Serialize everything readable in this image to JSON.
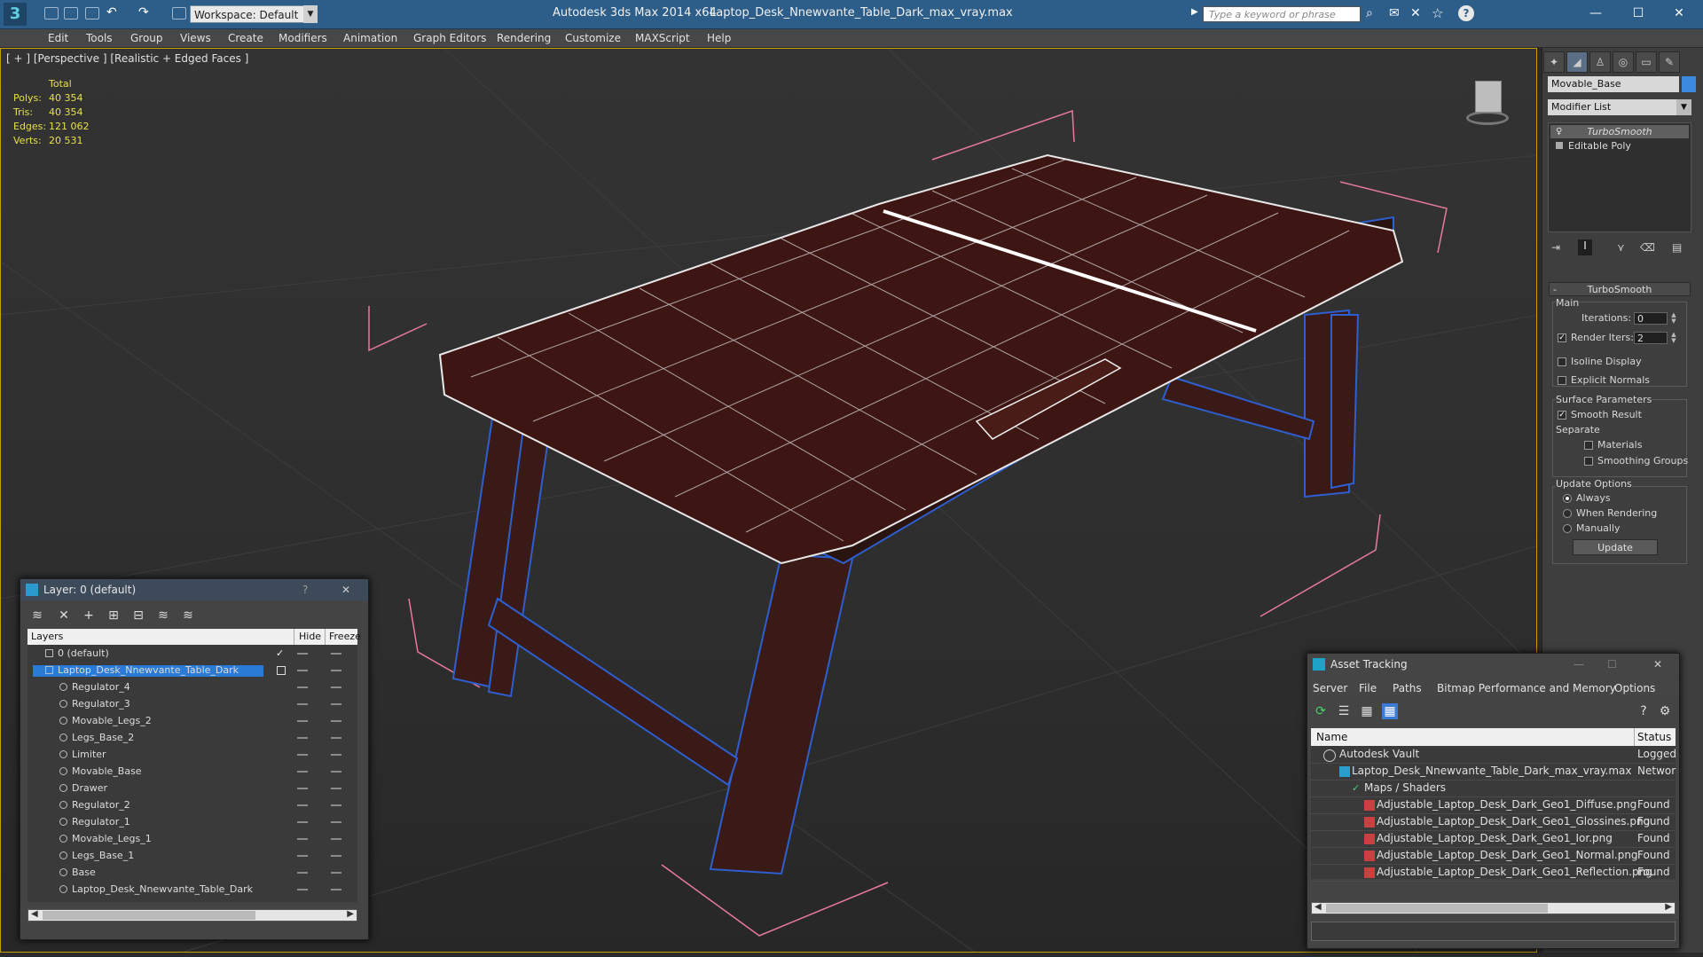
{
  "app": {
    "product_title": "Autodesk 3ds Max  2014 x64",
    "file_title": "Laptop_Desk_Nnewvante_Table_Dark_max_vray.max",
    "workspace_label": "Workspace: Default",
    "search_placeholder": "Type a keyword or phrase"
  },
  "menu": [
    "Edit",
    "Tools",
    "Group",
    "Views",
    "Create",
    "Modifiers",
    "Animation",
    "Graph Editors",
    "Rendering",
    "Customize",
    "MAXScript",
    "Help"
  ],
  "viewport": {
    "label": "[ + ] [Perspective ] [Realistic + Edged Faces ]",
    "stats_header": "Total",
    "stats": [
      {
        "key": "Polys:",
        "value": "40 354"
      },
      {
        "key": "Tris:",
        "value": "40 354"
      },
      {
        "key": "Edges:",
        "value": "121 062"
      },
      {
        "key": "Verts:",
        "value": "20 531"
      }
    ]
  },
  "command_panel": {
    "object_name": "Movable_Base",
    "object_color": "#3a8ae0",
    "modifier_list": "Modifier List",
    "stack": [
      "TurboSmooth",
      "Editable Poly"
    ],
    "turbosmooth": {
      "header": "TurboSmooth",
      "main": "Main",
      "iterations_label": "Iterations:",
      "iterations_value": "0",
      "render_iters_label": "Render Iters:",
      "render_iters_value": "2",
      "isoline": "Isoline Display",
      "explicit": "Explicit Normals",
      "surface_params": "Surface Parameters",
      "smooth_result": "Smooth Result",
      "separate": "Separate",
      "materials": "Materials",
      "smoothing_groups": "Smoothing Groups",
      "update_options": "Update Options",
      "always": "Always",
      "when_rendering": "When Rendering",
      "manually": "Manually",
      "update_button": "Update"
    }
  },
  "layer_window": {
    "title": "Layer: 0 (default)",
    "col_layers": "Layers",
    "col_hide": "Hide",
    "col_freeze": "Freeze",
    "rows": [
      {
        "name": "0 (default)",
        "level": 0
      },
      {
        "name": "Laptop_Desk_Nnewvante_Table_Dark",
        "level": 0,
        "selected": true
      },
      {
        "name": "Regulator_4",
        "level": 1
      },
      {
        "name": "Regulator_3",
        "level": 1
      },
      {
        "name": "Movable_Legs_2",
        "level": 1
      },
      {
        "name": "Legs_Base_2",
        "level": 1
      },
      {
        "name": "Limiter",
        "level": 1
      },
      {
        "name": "Movable_Base",
        "level": 1
      },
      {
        "name": "Drawer",
        "level": 1
      },
      {
        "name": "Regulator_2",
        "level": 1
      },
      {
        "name": "Regulator_1",
        "level": 1
      },
      {
        "name": "Movable_Legs_1",
        "level": 1
      },
      {
        "name": "Legs_Base_1",
        "level": 1
      },
      {
        "name": "Base",
        "level": 1
      },
      {
        "name": "Laptop_Desk_Nnewvante_Table_Dark",
        "level": 1
      }
    ]
  },
  "asset_window": {
    "title": "Asset Tracking",
    "menu": [
      "Server",
      "File",
      "Paths",
      "Bitmap Performance and Memory",
      "Options"
    ],
    "col_name": "Name",
    "col_status": "Status",
    "rows": [
      {
        "name": "Autodesk Vault",
        "status": "Logged",
        "level": 0
      },
      {
        "name": "Laptop_Desk_Nnewvante_Table_Dark_max_vray.max",
        "status": "Networ",
        "level": 1
      },
      {
        "name": "Maps / Shaders",
        "status": "",
        "level": 2
      },
      {
        "name": "Adjustable_Laptop_Desk_Dark_Geo1_Diffuse.png",
        "status": "Found",
        "level": 3
      },
      {
        "name": "Adjustable_Laptop_Desk_Dark_Geo1_Glossines.png",
        "status": "Found",
        "level": 3
      },
      {
        "name": "Adjustable_Laptop_Desk_Dark_Geo1_Ior.png",
        "status": "Found",
        "level": 3
      },
      {
        "name": "Adjustable_Laptop_Desk_Dark_Geo1_Normal.png",
        "status": "Found",
        "level": 3
      },
      {
        "name": "Adjustable_Laptop_Desk_Dark_Geo1_Reflection.png",
        "status": "Found",
        "level": 3
      }
    ]
  }
}
